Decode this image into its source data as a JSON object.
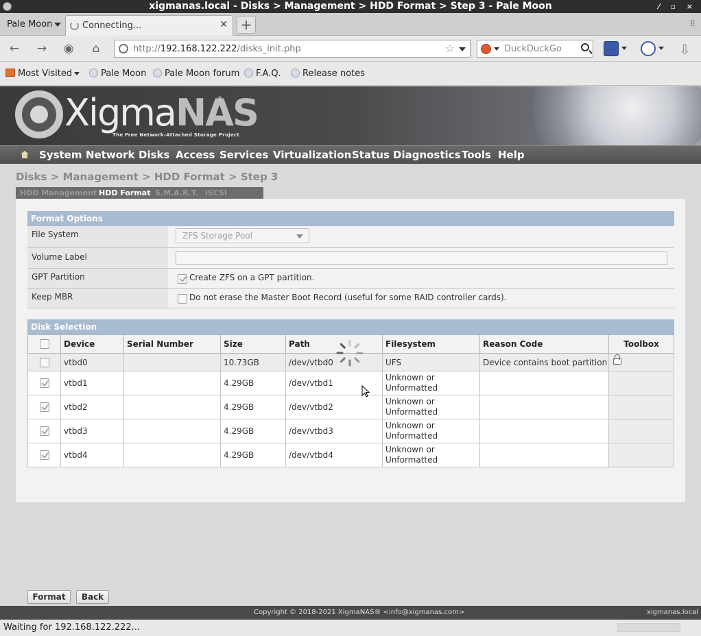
{
  "window": {
    "title": "xigmanas.local - Disks > Management > HDD Format > Step 3 - Pale Moon"
  },
  "browser": {
    "menu_label": "Pale Moon",
    "tab_title": "Connecting...",
    "url_prefix": "http://",
    "url_host": "192.168.122.222",
    "url_path": "/disks_init.php",
    "search_placeholder": "DuckDuckGo",
    "bookmarks": [
      "Most Visited",
      "Pale Moon",
      "Pale Moon forum",
      "F.A.Q.",
      "Release notes"
    ],
    "status_text": "Waiting for 192.168.122.222..."
  },
  "brand": {
    "logo_main": "Xigma",
    "logo_nas": "NAS",
    "logo_reg": "®",
    "tagline": "The Free Network-Attached Storage Project"
  },
  "menu": [
    "System",
    "Network",
    "Disks",
    "Access",
    "Services",
    "Virtualization",
    "Status",
    "Diagnostics",
    "Tools",
    "Help"
  ],
  "breadcrumb": "Disks > Management > HDD Format > Step 3",
  "subtabs": [
    "HDD Management",
    "HDD Format",
    "S.M.A.R.T.",
    "iSCSI Initiator"
  ],
  "active_subtab": "HDD Format",
  "format_options": {
    "heading": "Format Options",
    "file_system_label": "File System",
    "file_system_value": "ZFS Storage Pool",
    "volume_label_label": "Volume Label",
    "volume_label_value": "",
    "gpt_label": "GPT Partition",
    "gpt_text": "Create ZFS on a GPT partition.",
    "gpt_checked": true,
    "mbr_label": "Keep MBR",
    "mbr_text": "Do not erase the Master Boot Record (useful for some RAID controller cards).",
    "mbr_checked": false
  },
  "disk_selection": {
    "heading": "Disk Selection",
    "columns": [
      "Device",
      "Serial Number",
      "Size",
      "Path",
      "Filesystem",
      "Reason Code",
      "Toolbox"
    ],
    "rows": [
      {
        "device": "vtbd0",
        "serial": "",
        "size": "10.73GB",
        "path": "/dev/vtbd0",
        "filesystem": "UFS",
        "reason": "Device contains boot partition",
        "checked": false
      },
      {
        "device": "vtbd1",
        "serial": "",
        "size": "4.29GB",
        "path": "/dev/vtbd1",
        "filesystem": "Unknown or Unformatted",
        "reason": "",
        "checked": true
      },
      {
        "device": "vtbd2",
        "serial": "",
        "size": "4.29GB",
        "path": "/dev/vtbd2",
        "filesystem": "Unknown or Unformatted",
        "reason": "",
        "checked": true
      },
      {
        "device": "vtbd3",
        "serial": "",
        "size": "4.29GB",
        "path": "/dev/vtbd3",
        "filesystem": "Unknown or Unformatted",
        "reason": "",
        "checked": true
      },
      {
        "device": "vtbd4",
        "serial": "",
        "size": "4.29GB",
        "path": "/dev/vtbd4",
        "filesystem": "Unknown or Unformatted",
        "reason": "",
        "checked": true
      }
    ]
  },
  "buttons": {
    "format": "Format",
    "back": "Back"
  },
  "footer": {
    "copyright": "Copyright © 2018-2021 XigmaNAS® <info@xigmanas.com>",
    "host": "xigmanas.local"
  }
}
